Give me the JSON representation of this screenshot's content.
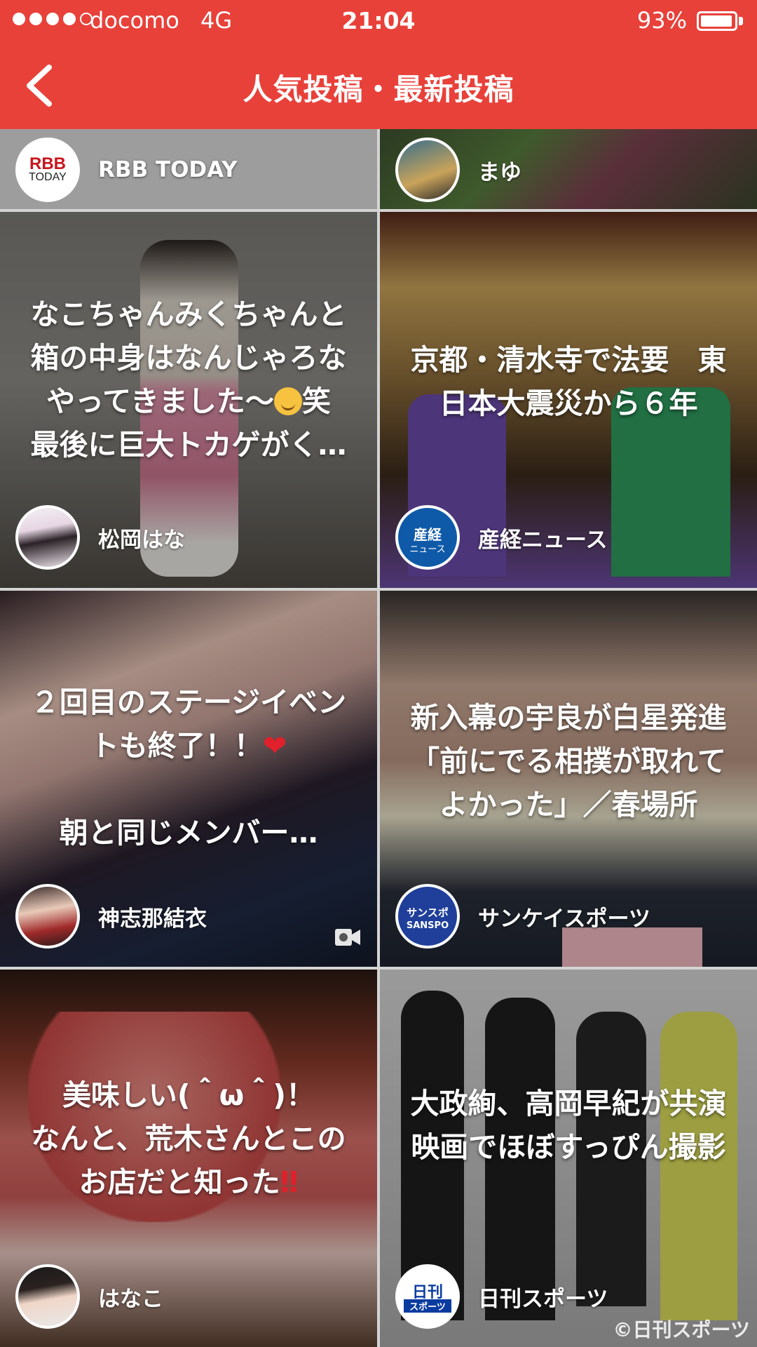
{
  "status_bar": {
    "carrier": "docomo",
    "network": "4G",
    "time": "21:04",
    "battery": "93%",
    "battery_level": 0.93
  },
  "nav": {
    "back_icon": "chevron-left-icon",
    "title": "人気投稿・最新投稿"
  },
  "colors": {
    "brand": "#e8413a",
    "heart": "#e0202a"
  },
  "partial_row": [
    {
      "author": "RBB TODAY",
      "logo_top": "RBB",
      "logo_bottom": "TODAY"
    },
    {
      "author": "まゆ"
    }
  ],
  "posts": [
    {
      "lines": [
        "なこちゃんみくちゃんと",
        "箱の中身はなんじゃろな",
        "やってきました〜",
        "最後に巨大トカゲがく…"
      ],
      "emoji": "smiling-blush-emoji",
      "line3_suffix": "笑",
      "author": "松岡はな"
    },
    {
      "lines": [
        "京都・清水寺で法要　東",
        "日本大震災から６年"
      ],
      "author": "産経ニュース",
      "logo_top": "産経",
      "logo_bottom": "ニュース"
    },
    {
      "lines": [
        "２回目のステージイベン",
        "トも終了！！",
        "",
        "朝と同じメンバー…"
      ],
      "emoji": "heart-emoji",
      "heart_char": "❤",
      "author": "神志那結衣",
      "has_video": true
    },
    {
      "lines": [
        "新入幕の宇良が白星発進",
        "「前にでる相撲が取れて",
        "よかった」／春場所"
      ],
      "author": "サンケイスポーツ",
      "logo_top": "サンスポ",
      "logo_bottom": "SANSPO"
    },
    {
      "lines": [
        "美味しい(＾ω＾)！",
        "なんと、荒木さんとこの",
        "お店だと知った"
      ],
      "emoji": "double-exclamation-emoji",
      "bangs_char": "‼",
      "author": "はなこ"
    },
    {
      "lines": [
        "大政絢、高岡早紀が共演",
        "映画でほぼすっぴん撮影"
      ],
      "author": "日刊スポーツ",
      "logo_top": "日刊",
      "logo_bottom": "スポーツ",
      "watermark": "©日刊スポーツ"
    }
  ]
}
